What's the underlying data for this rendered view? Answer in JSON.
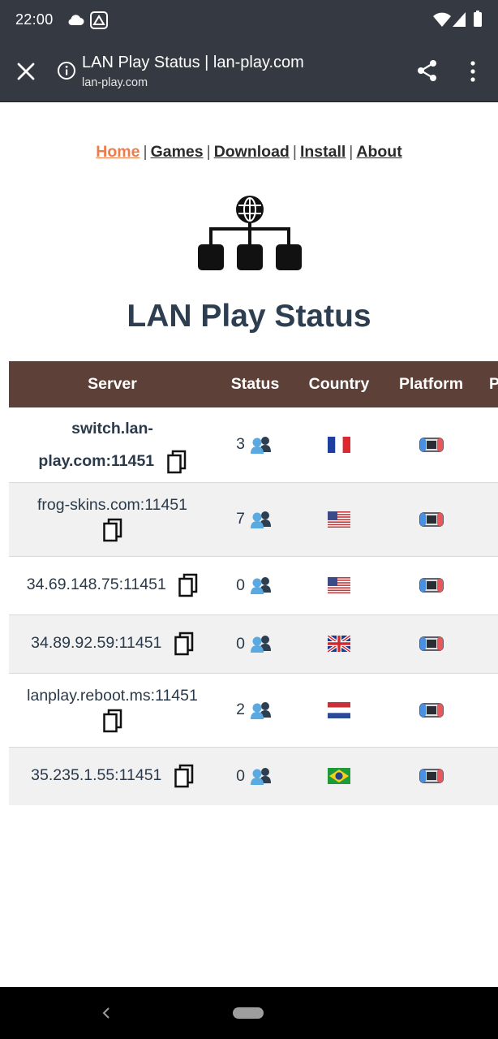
{
  "statusbar": {
    "time": "22:00"
  },
  "toolbar": {
    "title": "LAN Play Status | lan-play.com",
    "url": "lan-play.com"
  },
  "nav": {
    "items": [
      {
        "label": "Home",
        "active": true
      },
      {
        "label": "Games"
      },
      {
        "label": "Download"
      },
      {
        "label": "Install"
      },
      {
        "label": "About"
      }
    ],
    "separator": "|"
  },
  "page_title": "LAN Play Status",
  "table": {
    "headers": [
      "Server",
      "Status",
      "Country",
      "Platform",
      "P"
    ],
    "rows": [
      {
        "server_line1": "switch.lan-",
        "server_line2": "play.com:11451",
        "status": "3",
        "country": "France",
        "platform": "switch-icon"
      },
      {
        "server": "frog-skins.com:11451",
        "status": "7",
        "country": "USA",
        "platform": "switch-icon"
      },
      {
        "server": "34.69.148.75:11451",
        "status": "0",
        "country": "USA",
        "platform": "switch-icon"
      },
      {
        "server": "34.89.92.59:11451",
        "status": "0",
        "country": "UK",
        "platform": "switch-icon"
      },
      {
        "server": "lanplay.reboot.ms:11451",
        "status": "2",
        "country": "Netherlands",
        "platform": "switch-icon"
      },
      {
        "server": "35.235.1.55:11451",
        "status": "0",
        "country": "Brazil",
        "platform": "switch-icon"
      }
    ]
  },
  "colors": {
    "header_bg": "#5d4037",
    "active_link": "#ee7c4a",
    "title": "#2c3e50",
    "chrome_bg": "#353a42"
  }
}
